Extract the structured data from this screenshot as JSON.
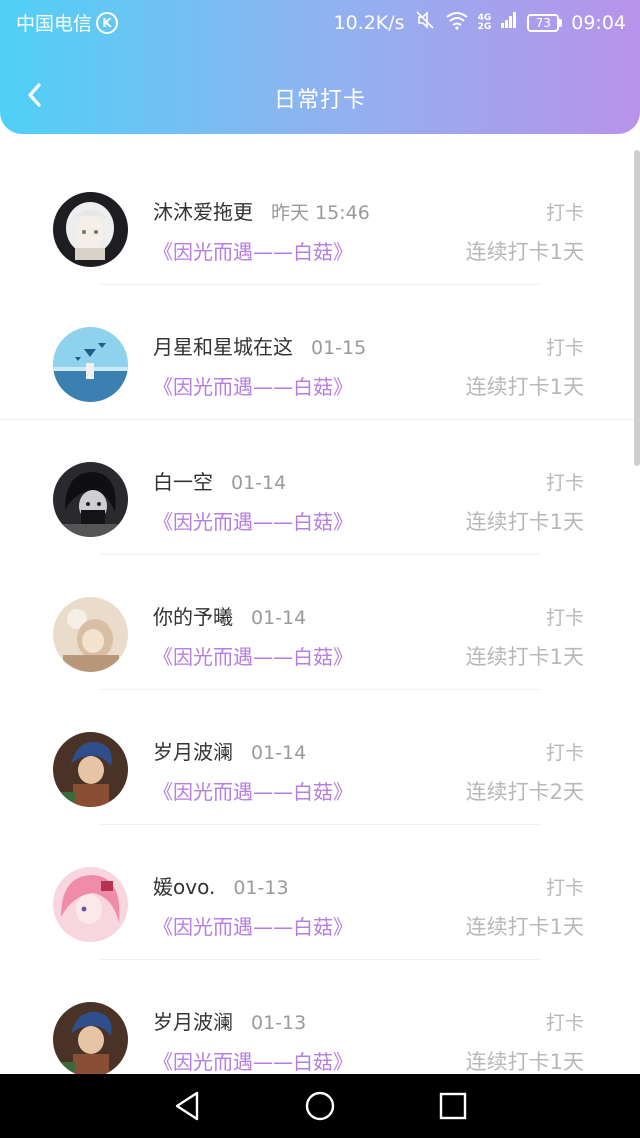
{
  "status_bar": {
    "carrier": "中国电信",
    "carrier_badge": "K",
    "network_speed": "10.2K/s",
    "net_type_top": "4G",
    "net_type_bottom": "2G",
    "battery": "73",
    "time": "09:04"
  },
  "nav": {
    "title": "日常打卡"
  },
  "list": {
    "items": [
      {
        "name": "沐沐爱拖更",
        "time": "昨天 15:46",
        "book": "《因光而遇——白菇》",
        "action": "打卡",
        "streak": "连续打卡1天"
      },
      {
        "name": "月星和星城在这",
        "time": "01-15",
        "book": "《因光而遇——白菇》",
        "action": "打卡",
        "streak": "连续打卡1天"
      },
      {
        "name": "白一空",
        "time": "01-14",
        "book": "《因光而遇——白菇》",
        "action": "打卡",
        "streak": "连续打卡1天"
      },
      {
        "name": "你的予曦",
        "time": "01-14",
        "book": "《因光而遇——白菇》",
        "action": "打卡",
        "streak": "连续打卡1天"
      },
      {
        "name": "岁月波澜",
        "time": "01-14",
        "book": "《因光而遇——白菇》",
        "action": "打卡",
        "streak": "连续打卡2天"
      },
      {
        "name": "媛ovo.",
        "time": "01-13",
        "book": "《因光而遇——白菇》",
        "action": "打卡",
        "streak": "连续打卡1天"
      },
      {
        "name": "岁月波澜",
        "time": "01-13",
        "book": "《因光而遇——白菇》",
        "action": "打卡",
        "streak": "连续打卡1天"
      }
    ]
  },
  "colors": {
    "header_start": "#4fd0f6",
    "header_end": "#b793ea",
    "book_title": "#b57ee1",
    "muted": "#b8b8b8"
  }
}
